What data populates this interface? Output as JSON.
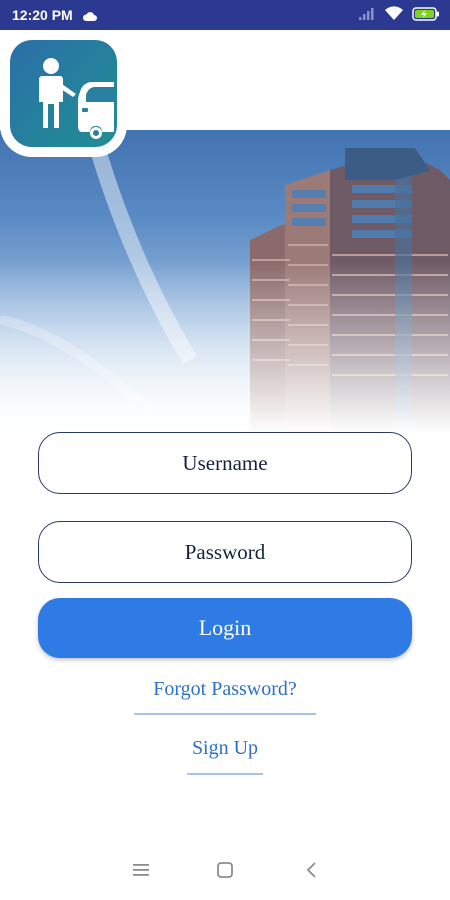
{
  "status_bar": {
    "time": "12:20 PM",
    "icons": [
      "cloud-icon",
      "signal-icon",
      "wifi-icon",
      "battery-charging-icon"
    ]
  },
  "app": {
    "logo_icon": "person-car-icon",
    "colors": {
      "accent": "#2f7be5",
      "status_bar": "#2b3990",
      "link": "#2d6fc8"
    }
  },
  "form": {
    "username_placeholder": "Username",
    "password_placeholder": "Password",
    "login_label": "Login",
    "forgot_label": "Forgot Password?",
    "signup_label": "Sign Up"
  },
  "nav_bar": {
    "icons": [
      "menu-icon",
      "home-square-icon",
      "back-icon"
    ]
  }
}
